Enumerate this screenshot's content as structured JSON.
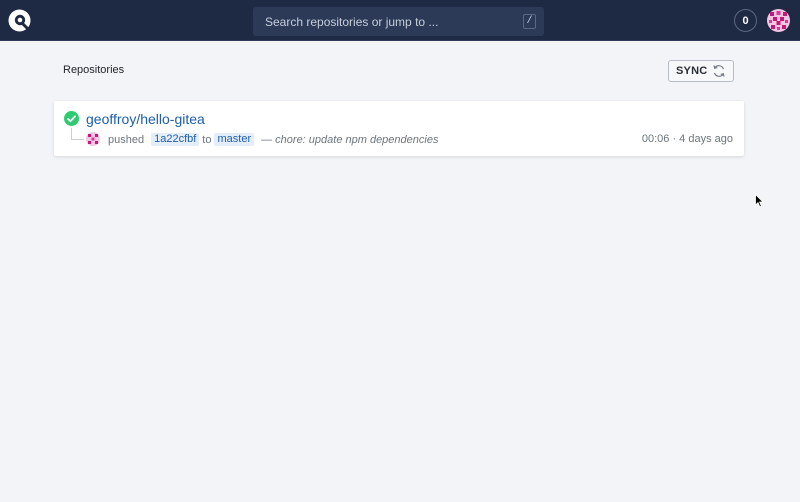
{
  "header": {
    "logo_icon": "drone-logo-icon",
    "search": {
      "placeholder": "Search repositories or jump to ...",
      "shortcut": "/"
    },
    "notification_count": "0",
    "avatar_icon": "user-avatar-icon"
  },
  "main": {
    "title": "Repositories",
    "sync_label": "SYNC",
    "sync_icon": "refresh-icon"
  },
  "repos": [
    {
      "name": "geoffroy/hello-gitea",
      "status": "success",
      "status_icon": "check-circle-icon",
      "action": "pushed",
      "commit": "1a22cfbf",
      "to_label": "to",
      "branch": "master",
      "message": "— chore: update npm dependencies",
      "duration": "00:06",
      "separator": "·",
      "time_ago": "4 days ago"
    }
  ],
  "colors": {
    "topbar": "#1e2a44",
    "success": "#2ecc71",
    "link": "#1f5ea8",
    "background": "#f2f4f8"
  }
}
